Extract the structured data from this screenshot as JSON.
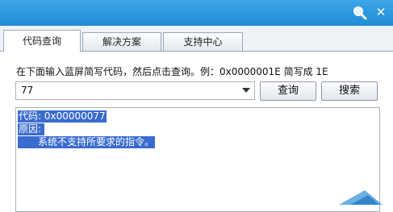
{
  "tabs": [
    "代码查询",
    "解决方案",
    "支持中心"
  ],
  "hint": "在下面输入蓝屏简写代码，然后点击查询。例：0x0000001E 简写成 1E",
  "combo": {
    "value": "77"
  },
  "buttons": {
    "query": "查询",
    "search": "搜索"
  },
  "result": {
    "code_line": "代码: 0x00000077",
    "reason_label": "原因:",
    "reason_text": "系统不支持所要求的指令。"
  }
}
